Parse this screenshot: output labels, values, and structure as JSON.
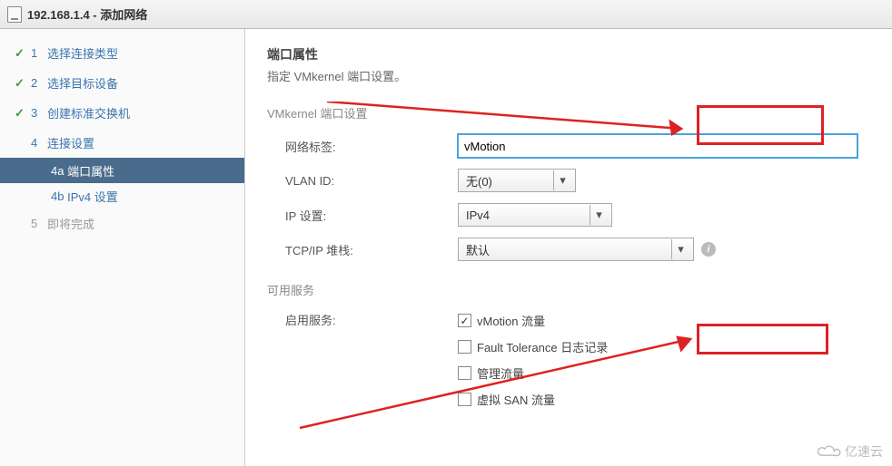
{
  "window": {
    "title": "192.168.1.4 - 添加网络"
  },
  "sidebar": {
    "steps": [
      {
        "num": "1",
        "label": "选择连接类型"
      },
      {
        "num": "2",
        "label": "选择目标设备"
      },
      {
        "num": "3",
        "label": "创建标准交换机"
      },
      {
        "num": "4",
        "label": "连接设置"
      },
      {
        "num": "5",
        "label": "即将完成"
      }
    ],
    "substeps": [
      {
        "key": "4a",
        "label": "端口属性"
      },
      {
        "key": "4b",
        "label": "IPv4 设置"
      }
    ]
  },
  "main": {
    "title": "端口属性",
    "subtitle": "指定 VMkernel 端口设置。",
    "group1": "VMkernel 端口设置",
    "labels": {
      "netlabel": "网络标签:",
      "vlanid": "VLAN ID:",
      "ipset": "IP 设置:",
      "tcpip": "TCP/IP 堆栈:"
    },
    "values": {
      "netlabel": "vMotion",
      "vlanid": "无(0)",
      "ipset": "IPv4",
      "tcpip": "默认"
    },
    "group2": "可用服务",
    "enable_label": "启用服务:",
    "services": [
      {
        "label": "vMotion 流量",
        "checked": true
      },
      {
        "label": "Fault Tolerance 日志记录",
        "checked": false
      },
      {
        "label": "管理流量",
        "checked": false
      },
      {
        "label": "虚拟 SAN 流量",
        "checked": false
      }
    ]
  },
  "watermark": "亿速云"
}
